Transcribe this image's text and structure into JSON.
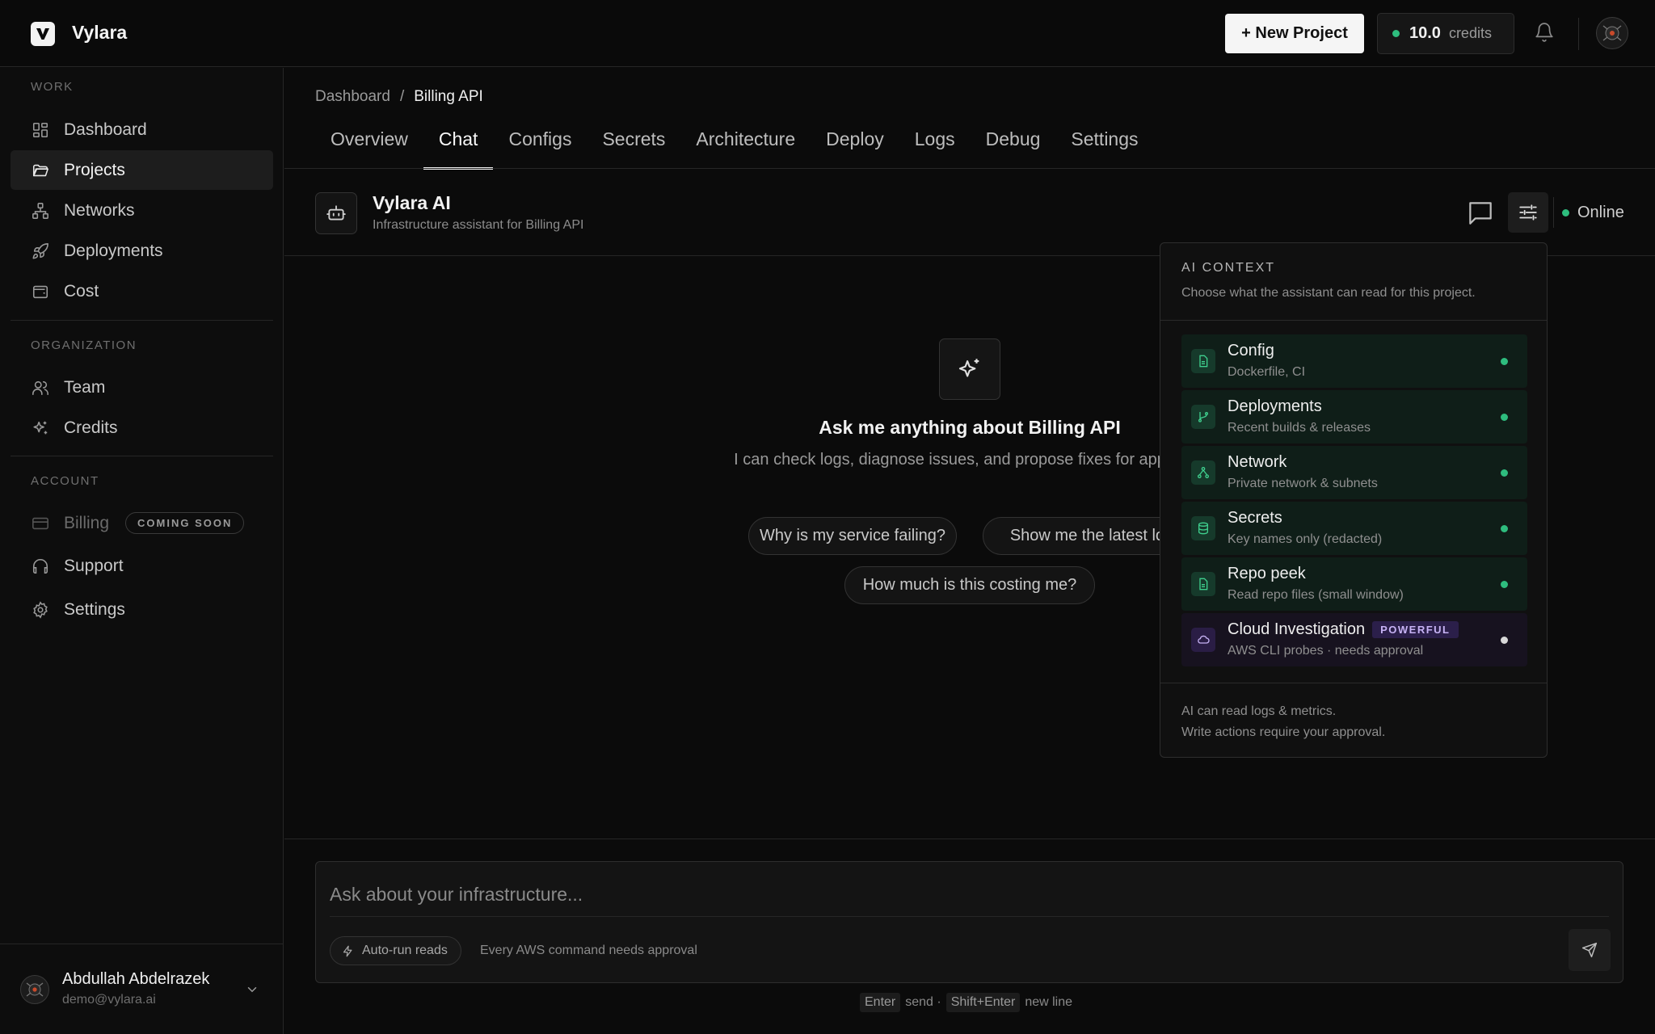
{
  "brand": {
    "name": "Vylara"
  },
  "topbar": {
    "new_project_label": "+ New Project",
    "credits_amount": "10.0",
    "credits_unit": "credits"
  },
  "sidebar": {
    "sections": [
      {
        "label": "WORK",
        "items": [
          {
            "label": "Dashboard",
            "icon": "grid-icon"
          },
          {
            "label": "Projects",
            "icon": "folder-icon",
            "active": true
          },
          {
            "label": "Networks",
            "icon": "network-icon"
          },
          {
            "label": "Deployments",
            "icon": "rocket-icon"
          },
          {
            "label": "Cost",
            "icon": "wallet-icon"
          }
        ]
      },
      {
        "label": "ORGANIZATION",
        "items": [
          {
            "label": "Team",
            "icon": "users-icon"
          },
          {
            "label": "Credits",
            "icon": "sparkles-icon"
          }
        ]
      },
      {
        "label": "ACCOUNT",
        "items": [
          {
            "label": "Billing",
            "icon": "card-icon",
            "badge": "COMING SOON",
            "disabled": true
          },
          {
            "label": "Support",
            "icon": "headphones-icon"
          },
          {
            "label": "Settings",
            "icon": "gear-icon"
          }
        ]
      }
    ]
  },
  "user": {
    "name": "Abdullah Abdelrazek",
    "email": "demo@vylara.ai"
  },
  "breadcrumb": {
    "root": "Dashboard",
    "separator": "/",
    "current": "Billing API"
  },
  "tabs": [
    "Overview",
    "Chat",
    "Configs",
    "Secrets",
    "Architecture",
    "Deploy",
    "Logs",
    "Debug",
    "Settings"
  ],
  "active_tab": "Chat",
  "assistant": {
    "name": "Vylara AI",
    "subtitle": "Infrastructure assistant for Billing API",
    "status": "Online"
  },
  "empty_state": {
    "title": "Ask me anything about Billing API",
    "description": "I can check logs, diagnose issues, and propose fixes for approval.",
    "suggestions": [
      "Why is my service failing?",
      "Show me the latest logs",
      "How much is this costing me?"
    ]
  },
  "context_panel": {
    "title": "AI CONTEXT",
    "description": "Choose what the assistant can read for this project.",
    "items": [
      {
        "name": "Config",
        "sub": "Dockerfile, CI",
        "icon": "file-icon"
      },
      {
        "name": "Deployments",
        "sub": "Recent builds & releases",
        "icon": "git-branch-icon"
      },
      {
        "name": "Network",
        "sub": "Private network & subnets",
        "icon": "network-icon"
      },
      {
        "name": "Secrets",
        "sub": "Key names only (redacted)",
        "icon": "database-icon"
      },
      {
        "name": "Repo peek",
        "sub": "Read repo files (small window)",
        "icon": "file-icon"
      },
      {
        "name": "Cloud Investigation",
        "badge": "POWERFUL",
        "sub": "AWS CLI probes · needs approval",
        "icon": "cloud-icon"
      }
    ],
    "footer_line1": "AI can read logs & metrics.",
    "footer_line2": "Write actions require your approval."
  },
  "composer": {
    "placeholder": "Ask about your infrastructure...",
    "autorun_label": "Auto-run reads",
    "approval_note": "Every AWS command needs approval"
  },
  "hint": {
    "enter_key": "Enter",
    "enter_action": "send ·",
    "shift_key": "Shift+Enter",
    "shift_action": "new line"
  },
  "colors": {
    "accent_green": "#2ebd7e",
    "badge_purple": "#c7b3f5",
    "background": "#0b0b0b"
  }
}
